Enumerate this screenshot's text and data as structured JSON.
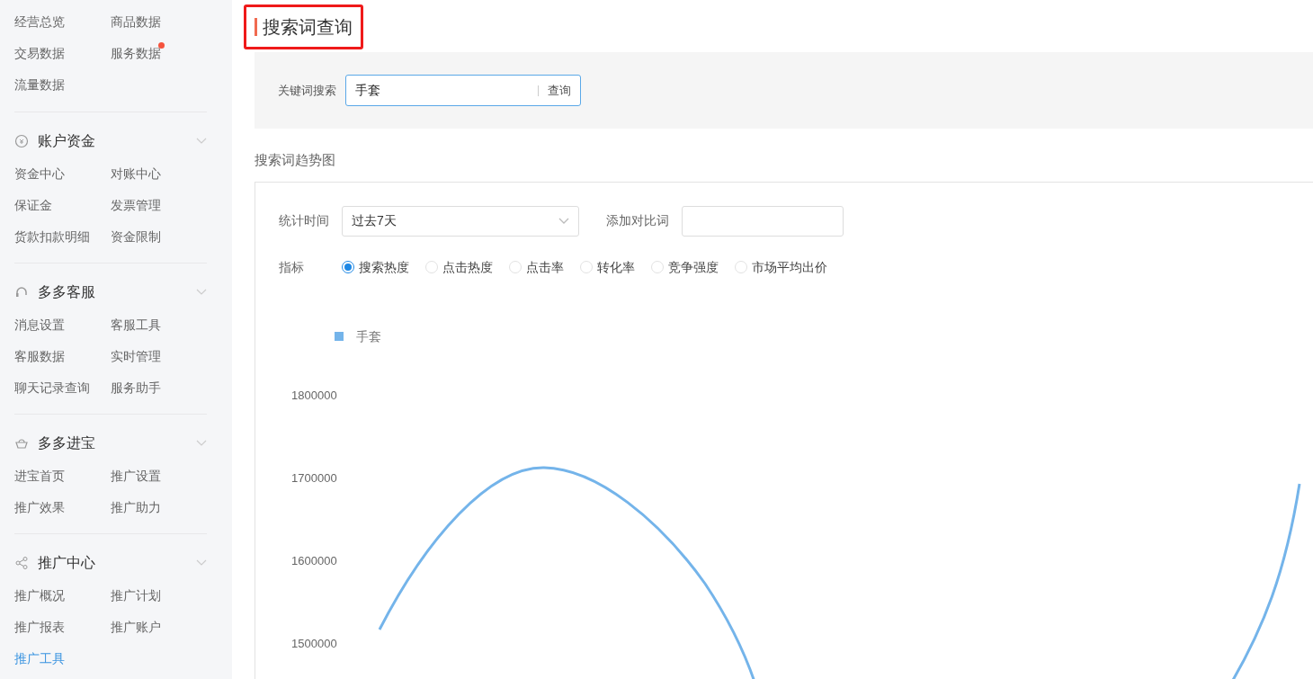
{
  "sidebar": {
    "top_items": [
      {
        "label": "经营总览",
        "badge": false
      },
      {
        "label": "商品数据",
        "badge": false
      },
      {
        "label": "交易数据",
        "badge": false
      },
      {
        "label": "服务数据",
        "badge": true
      },
      {
        "label": "流量数据",
        "badge": false
      }
    ],
    "sections": [
      {
        "title": "账户资金",
        "expanded": true,
        "items": [
          {
            "label": "资金中心",
            "selected": false
          },
          {
            "label": "对账中心",
            "selected": false
          },
          {
            "label": "保证金",
            "selected": false
          },
          {
            "label": "发票管理",
            "selected": false
          },
          {
            "label": "货款扣款明细",
            "selected": false
          },
          {
            "label": "资金限制",
            "selected": false
          }
        ]
      },
      {
        "title": "多多客服",
        "expanded": true,
        "items": [
          {
            "label": "消息设置",
            "selected": false
          },
          {
            "label": "客服工具",
            "selected": false
          },
          {
            "label": "客服数据",
            "selected": false
          },
          {
            "label": "实时管理",
            "selected": false
          },
          {
            "label": "聊天记录查询",
            "selected": false
          },
          {
            "label": "服务助手",
            "selected": false
          }
        ]
      },
      {
        "title": "多多进宝",
        "expanded": true,
        "items": [
          {
            "label": "进宝首页",
            "selected": false
          },
          {
            "label": "推广设置",
            "selected": false
          },
          {
            "label": "推广效果",
            "selected": false
          },
          {
            "label": "推广助力",
            "selected": false
          }
        ]
      },
      {
        "title": "推广中心",
        "expanded": true,
        "items": [
          {
            "label": "推广概况",
            "selected": false
          },
          {
            "label": "推广计划",
            "selected": false
          },
          {
            "label": "推广报表",
            "selected": false
          },
          {
            "label": "推广账户",
            "selected": false
          },
          {
            "label": "推广工具",
            "selected": true
          }
        ]
      }
    ]
  },
  "page_title": "搜索词查询",
  "search": {
    "label": "关键词搜索",
    "value": "手套",
    "button": "查询"
  },
  "trend": {
    "title": "搜索词趋势图",
    "period_label": "统计时间",
    "period_value": "过去7天",
    "compare_label": "添加对比词",
    "metric_label": "指标",
    "metrics": [
      {
        "label": "搜索热度",
        "selected": true
      },
      {
        "label": "点击热度",
        "selected": false
      },
      {
        "label": "点击率",
        "selected": false
      },
      {
        "label": "转化率",
        "selected": false
      },
      {
        "label": "竞争强度",
        "selected": false
      },
      {
        "label": "市场平均出价",
        "selected": false
      }
    ],
    "legend": "手套",
    "y_axis_labels": [
      "1800000",
      "1700000",
      "1600000",
      "1500000"
    ]
  }
}
